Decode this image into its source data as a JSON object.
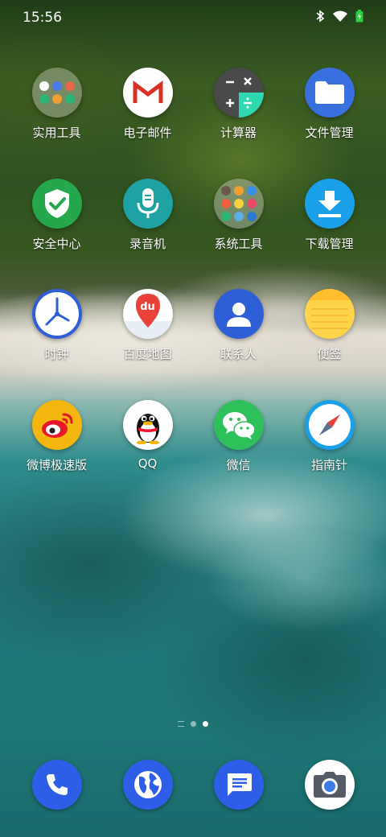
{
  "status_bar": {
    "time": "15:56",
    "icons": [
      "bluetooth-icon",
      "wifi-icon",
      "battery-icon"
    ]
  },
  "apps": [
    {
      "label": "实用工具",
      "icon": "utility-folder-icon"
    },
    {
      "label": "电子邮件",
      "icon": "gmail-icon"
    },
    {
      "label": "计算器",
      "icon": "calculator-icon"
    },
    {
      "label": "文件管理",
      "icon": "folder-icon"
    },
    {
      "label": "安全中心",
      "icon": "shield-check-icon"
    },
    {
      "label": "录音机",
      "icon": "microphone-icon"
    },
    {
      "label": "系统工具",
      "icon": "system-folder-icon"
    },
    {
      "label": "下载管理",
      "icon": "download-icon"
    },
    {
      "label": "时钟",
      "icon": "clock-icon"
    },
    {
      "label": "百度地图",
      "icon": "baidu-map-icon"
    },
    {
      "label": "联系人",
      "icon": "contact-person-icon"
    },
    {
      "label": "便签",
      "icon": "notes-icon"
    },
    {
      "label": "微博极速版",
      "icon": "weibo-icon"
    },
    {
      "label": "QQ",
      "icon": "qq-penguin-icon"
    },
    {
      "label": "微信",
      "icon": "wechat-icon"
    },
    {
      "label": "指南针",
      "icon": "compass-icon"
    }
  ],
  "map_icon_text": "du",
  "page_indicator": {
    "pages": 3,
    "current": 3
  },
  "dock": [
    {
      "icon": "phone-icon"
    },
    {
      "icon": "browser-globe-icon"
    },
    {
      "icon": "messages-icon"
    },
    {
      "icon": "camera-icon"
    }
  ],
  "colors": {
    "contacts": "#2f5fd6",
    "files": "#3a6fe0",
    "security": "#25a74b",
    "recorder": "#1fa2a4",
    "download": "#1aa0e8",
    "notes": "#ffd34a",
    "weibo": "#f5b60d",
    "wechat": "#2ec05b",
    "dock_blue": "#2e5ee8"
  }
}
